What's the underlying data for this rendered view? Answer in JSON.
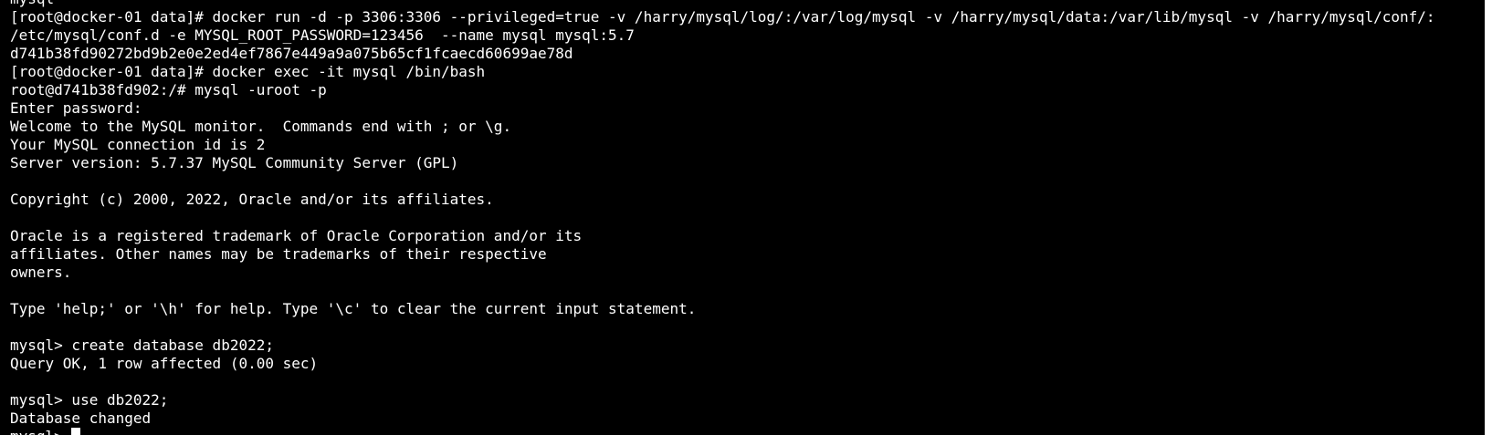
{
  "terminal": {
    "lines": [
      "mysql",
      "[root@docker-01 data]# docker run -d -p 3306:3306 --privileged=true -v /harry/mysql/log/:/var/log/mysql -v /harry/mysql/data:/var/lib/mysql -v /harry/mysql/conf/:",
      "/etc/mysql/conf.d -e MYSQL_ROOT_PASSWORD=123456  --name mysql mysql:5.7",
      "d741b38fd90272bd9b2e0e2ed4ef7867e449a9a075b65cf1fcaecd60699ae78d",
      "[root@docker-01 data]# docker exec -it mysql /bin/bash",
      "root@d741b38fd902:/# mysql -uroot -p",
      "Enter password:",
      "Welcome to the MySQL monitor.  Commands end with ; or \\g.",
      "Your MySQL connection id is 2",
      "Server version: 5.7.37 MySQL Community Server (GPL)",
      "",
      "Copyright (c) 2000, 2022, Oracle and/or its affiliates.",
      "",
      "Oracle is a registered trademark of Oracle Corporation and/or its",
      "affiliates. Other names may be trademarks of their respective",
      "owners.",
      "",
      "Type 'help;' or '\\h' for help. Type '\\c' to clear the current input statement.",
      "",
      "mysql> create database db2022;",
      "Query OK, 1 row affected (0.00 sec)",
      "",
      "mysql> use db2022;",
      "Database changed"
    ],
    "prompt": "mysql> ",
    "background_color": "#000000",
    "text_color": "#ffffff"
  }
}
